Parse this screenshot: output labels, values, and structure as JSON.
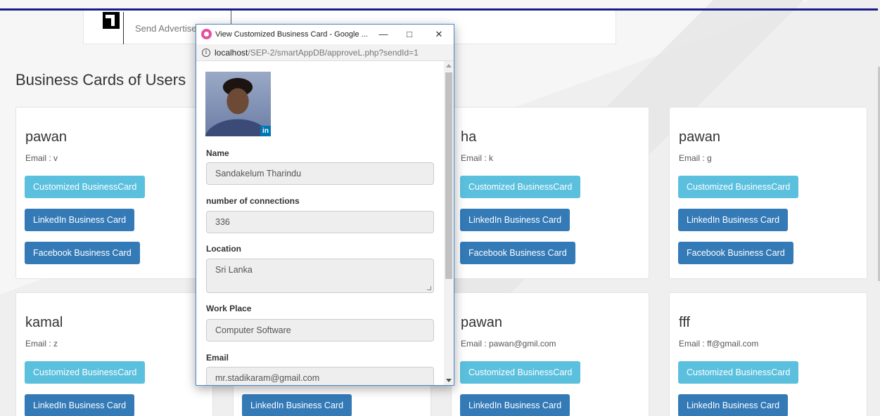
{
  "toolbar": {
    "send_label": "Send Advertise"
  },
  "page": {
    "title": "Business Cards of Users"
  },
  "button_labels": {
    "customized": "Customized BusinessCard",
    "linkedin": "LinkedIn Business Card",
    "facebook": "Facebook Business Card"
  },
  "cards": [
    {
      "name": "pawan",
      "email": "Email : v"
    },
    {
      "name": "ha",
      "email": "Email : k"
    },
    {
      "name": "pawan",
      "email": "Email : g"
    },
    {
      "name": "kamal",
      "email": "Email : z"
    },
    {
      "name": "pawan",
      "email": "Email : pawan@gmil.com"
    },
    {
      "name": "fff",
      "email": "Email : ff@gmail.com"
    }
  ],
  "popup": {
    "window_title": "View Customized Business Card - Google ...",
    "url_host": "localhost",
    "url_path": "/SEP-2/smartAppDB/approveL.php?sendId=1",
    "linkedin_badge": "in",
    "fields": {
      "name_label": "Name",
      "name_value": "Sandakelum Tharindu",
      "connections_label": "number of connections",
      "connections_value": "336",
      "location_label": "Location",
      "location_value": "Sri Lanka",
      "workplace_label": "Work Place",
      "workplace_value": "Computer Software",
      "email_label": "Email",
      "email_value": "mr.stadikaram@gmail.com"
    }
  },
  "colors": {
    "info": "#5bc0de",
    "primary": "#337ab7",
    "accent_line": "#1a1a8a",
    "linkedin": "#0077b5"
  }
}
